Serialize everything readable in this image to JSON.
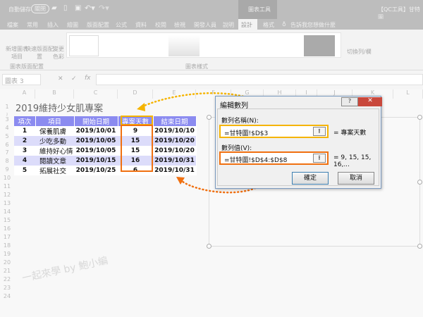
{
  "titlebar": {
    "autosave": "自動儲存",
    "autosave_state": "關閉",
    "chart_tools": "圖表工具",
    "doc_title": "【QC工具】甘特圖"
  },
  "tabs": [
    "檔案",
    "常用",
    "插入",
    "繪圖",
    "版面配置",
    "公式",
    "資料",
    "校閱",
    "檢視",
    "開發人員",
    "說明",
    "設計",
    "格式"
  ],
  "tell_me": "告訴我您想做什麼",
  "ribbon": {
    "add_element": "新增圖表項目",
    "quick_layout": "快速版面配置",
    "change_color": "變更色彩",
    "group_layout": "圖表版面配置",
    "group_styles": "圖表樣式",
    "switch": "切換列/欄"
  },
  "namebox": "圖表 3",
  "fx": "fx",
  "columns": [
    "A",
    "B",
    "C",
    "D",
    "E",
    "F",
    "G",
    "H",
    "I",
    "J",
    "K",
    "L"
  ],
  "rows": [
    "1",
    "2",
    "3",
    "4",
    "5",
    "6",
    "7",
    "8",
    "9",
    "10",
    "11",
    "12",
    "13",
    "14",
    "15",
    "16",
    "17",
    "18",
    "19",
    "20",
    "21",
    "22",
    "23",
    "24"
  ],
  "sheet_title": "2019維持少女肌專案",
  "table": {
    "headers": [
      "項次",
      "項目",
      "開始日期",
      "專案天數",
      "結束日期"
    ],
    "rows": [
      [
        "1",
        "保養肌膚",
        "2019/10/01",
        "9",
        "2019/10/10"
      ],
      [
        "2",
        "少吃多動",
        "2019/10/05",
        "15",
        "2019/10/20"
      ],
      [
        "3",
        "維持好心情",
        "2019/10/05",
        "15",
        "2019/10/20"
      ],
      [
        "4",
        "閱讀文章",
        "2019/10/15",
        "16",
        "2019/10/31"
      ],
      [
        "5",
        "拓展社交",
        "2019/10/25",
        "6",
        "2019/10/31"
      ]
    ]
  },
  "dialog": {
    "title": "編輯數列",
    "help": "?",
    "close": "✕",
    "name_label": "數列名稱(N):",
    "name_value": "=甘特圖!$D$3",
    "name_result": "= 專案天數",
    "values_label": "數列值(V):",
    "values_value": "=甘特圖!$D$4:$D$8",
    "values_result": "= 9, 15, 15, 16,...",
    "ok": "確定",
    "cancel": "取消"
  },
  "watermark": "一起來學 by 鮑小編",
  "colors": {
    "highlight_name": "#f5b400",
    "highlight_values": "#f07010",
    "table_header": "#8b8bf0"
  }
}
